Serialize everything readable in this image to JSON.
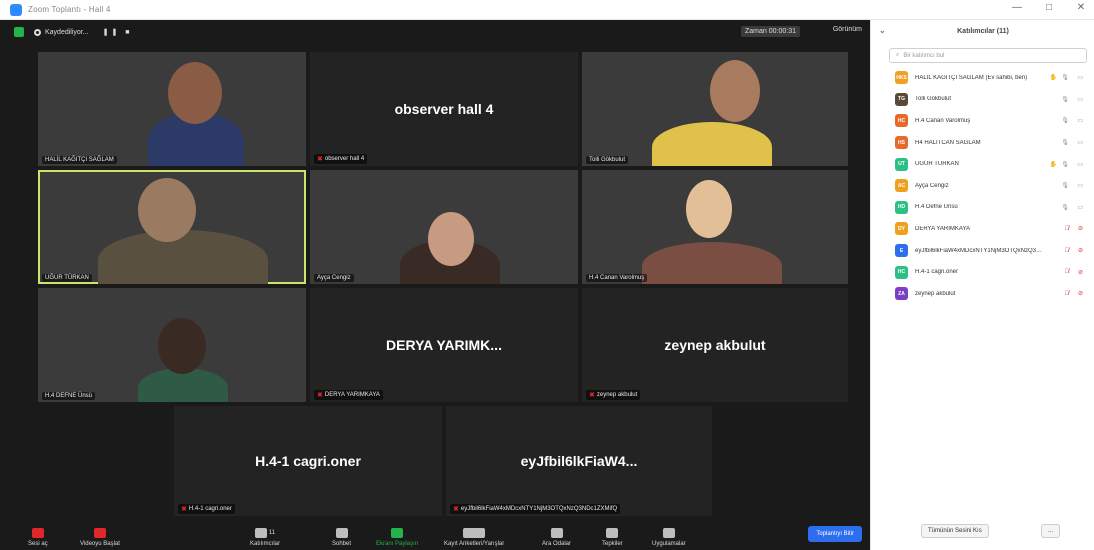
{
  "window": {
    "title": "Zoom Toplantı - Hall 4",
    "controls": [
      "—",
      "□",
      "✕"
    ]
  },
  "topbar": {
    "recording_label": "Kaydediliyor...",
    "record_controls": "❚❚ ■",
    "timer": "Zaman 00:00:31",
    "view_label": "Görünüm"
  },
  "tiles": [
    {
      "name": "HALİL KAĞITÇI SAĞLAM",
      "muted": false,
      "center": ""
    },
    {
      "name": "observer hall 4",
      "muted": true,
      "center": "observer hall 4"
    },
    {
      "name": "Tolli Gökbulut",
      "muted": false,
      "center": ""
    },
    {
      "name": "UĞUR TÜRKAN",
      "muted": false,
      "center": ""
    },
    {
      "name": "Ayça Cengiz",
      "muted": false,
      "center": ""
    },
    {
      "name": "H.4 Canan Varolmuş",
      "muted": false,
      "center": ""
    },
    {
      "name": "H.4 DEFNE Ünsü",
      "muted": false,
      "center": ""
    },
    {
      "name": "DERYA YARIMKAYA",
      "muted": true,
      "center": "DERYA YARIMK..."
    },
    {
      "name": "zeynep akbulut",
      "muted": true,
      "center": "zeynep akbulut"
    },
    {
      "name": "H.4-1 cagri.oner",
      "muted": true,
      "center": "H.4-1 cagri.oner"
    },
    {
      "name": "eyJfbil6lkFiaW4xMDcxNTY1NjM3OTQxNzQ3NDc1ZXMifQ",
      "muted": true,
      "center": "eyJfbil6lkFiaW4..."
    }
  ],
  "toolbar": {
    "mute": "Sesi aç",
    "video": "Videoyu Başlat",
    "participants": "Katılımcılar",
    "participants_count": "11",
    "chat": "Sohbet",
    "share": "Ekranı Paylaşın",
    "polls": "Kayıt Anketleri/Yarışlar",
    "rooms": "Ara Odalar",
    "reactions": "Tepkiler",
    "apps": "Uygulamalar",
    "end": "Toplantıyı Bitir"
  },
  "panel": {
    "title": "Katılımcılar (11)",
    "search_placeholder": "Bir katılımcı bul",
    "participants": [
      {
        "initials": "HKS",
        "name": "HALİL KAĞITÇI SAĞLAM (Ev sahibi, ben)",
        "color": "#f0a020",
        "mic_muted": false,
        "cam_off": false,
        "hand": "✋"
      },
      {
        "initials": "TG",
        "name": "Tolli Gökbulut",
        "color": "#5a4a3a",
        "mic_muted": false,
        "cam_off": false,
        "hand": ""
      },
      {
        "initials": "HC",
        "name": "H.4 Canan Varolmuş",
        "color": "#e86a2a",
        "mic_muted": false,
        "cam_off": false,
        "hand": ""
      },
      {
        "initials": "HS",
        "name": "H4 HALİTCAN SAĞLAM",
        "color": "#e86a2a",
        "mic_muted": false,
        "cam_off": false,
        "hand": ""
      },
      {
        "initials": "UT",
        "name": "UĞUR TÜRKAN",
        "color": "#2cbf86",
        "mic_muted": false,
        "cam_off": false,
        "hand": "✋"
      },
      {
        "initials": "AC",
        "name": "Ayça Cengiz",
        "color": "#f0a020",
        "mic_muted": false,
        "cam_off": false,
        "hand": ""
      },
      {
        "initials": "HD",
        "name": "H.4 Defne Ünsü",
        "color": "#2cbf86",
        "mic_muted": false,
        "cam_off": false,
        "hand": ""
      },
      {
        "initials": "DY",
        "name": "DERYA YARIMKAYA",
        "color": "#f0a020",
        "mic_muted": true,
        "cam_off": true,
        "hand": ""
      },
      {
        "initials": "E",
        "name": "eyJfbil6lkFiaW4xMDcxNTY1NjM3OTQxNzQ3NDc1ZXMifQ",
        "color": "#2d6ef0",
        "mic_muted": true,
        "cam_off": true,
        "hand": ""
      },
      {
        "initials": "HC",
        "name": "H.4-1 cagri.oner",
        "color": "#2cbf86",
        "mic_muted": true,
        "cam_off": true,
        "hand": ""
      },
      {
        "initials": "ZA",
        "name": "zeynep akbulut",
        "color": "#7a3fc4",
        "mic_muted": true,
        "cam_off": true,
        "hand": ""
      }
    ],
    "mute_all": "Tümünün Sesini Kıs",
    "more": "..."
  }
}
